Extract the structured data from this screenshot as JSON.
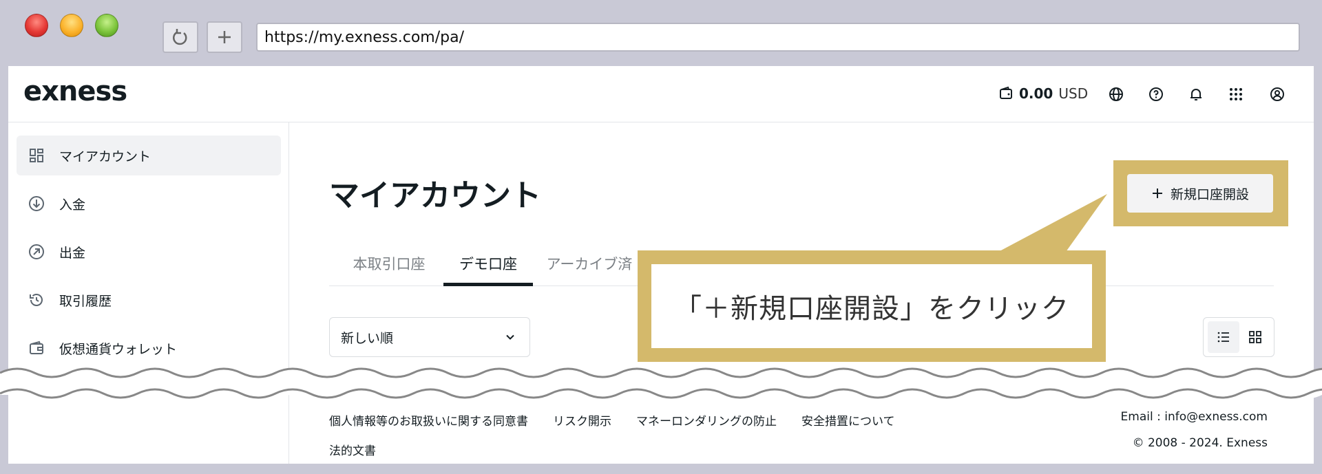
{
  "browser": {
    "url": "https://my.exness.com/pa/",
    "reload_label": "↺",
    "new_tab_label": "+"
  },
  "header": {
    "logo": "exness",
    "balance_amount": "0.00",
    "balance_currency": "USD",
    "icons": [
      "wallet-icon",
      "globe-icon",
      "help-icon",
      "bell-icon",
      "apps-grid-icon",
      "user-icon"
    ]
  },
  "sidebar": {
    "items": [
      {
        "label": "マイアカウント",
        "icon": "dashboard-icon",
        "active": true
      },
      {
        "label": "入金",
        "icon": "deposit-icon",
        "active": false
      },
      {
        "label": "出金",
        "icon": "withdraw-icon",
        "active": false
      },
      {
        "label": "取引履歴",
        "icon": "history-icon",
        "active": false
      },
      {
        "label": "仮想通貨ウォレット",
        "icon": "crypto-wallet-icon",
        "active": false
      }
    ]
  },
  "main": {
    "title": "マイアカウント",
    "new_account_button": "新規口座開設",
    "tabs": [
      {
        "label": "本取引口座",
        "active": false
      },
      {
        "label": "デモ口座",
        "active": true
      },
      {
        "label": "アーカイブ済",
        "active": false
      }
    ],
    "sort": {
      "selected": "新しい順"
    }
  },
  "callout": {
    "text": "「＋新規口座開設」をクリック"
  },
  "footer": {
    "links": [
      "個人情報等のお取扱いに関する同意書",
      "リスク開示",
      "マネーロンダリングの防止",
      "安全措置について"
    ],
    "legal": "法的文書",
    "email": "Email :  info@exness.com",
    "copyright": "© 2008 - 2024. Exness"
  },
  "colors": {
    "accent_gold": "#d4b96b",
    "text_dark": "#141d22",
    "tab_inactive": "#7b8085",
    "chrome_bg": "#c9c9d6"
  }
}
